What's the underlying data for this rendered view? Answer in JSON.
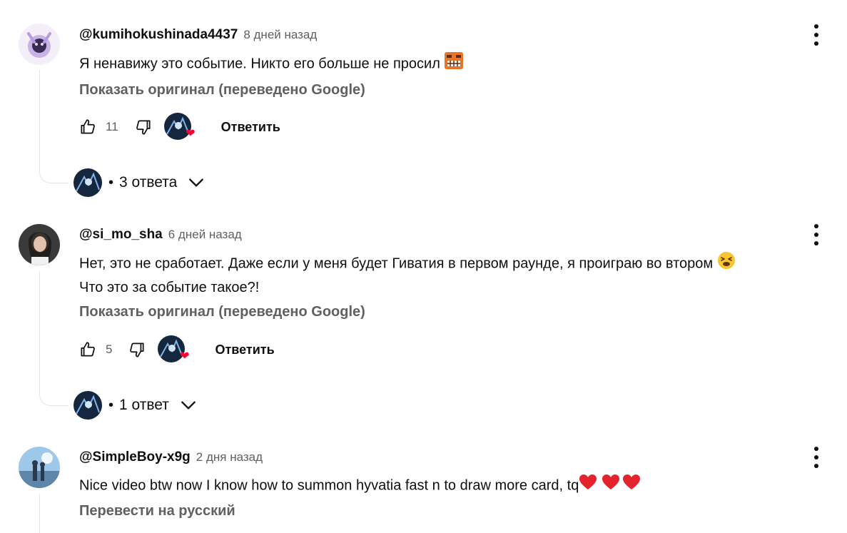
{
  "comments": [
    {
      "author": "@kumihokushinada4437",
      "time": "8 дней назад",
      "text_lines": [
        "Я ненавижу это событие. Никто его больше не просил"
      ],
      "translate_label": "Показать оригинал (переведено Google)",
      "likes": "11",
      "reply_label": "Ответить",
      "replies_label": "3 ответа",
      "emoji": "angry-face-emoji"
    },
    {
      "author": "@si_mo_sha",
      "time": "6 дней назад",
      "text_lines": [
        "Нет, это не сработает. Даже если у меня будет Гиватия в первом раунде, я проиграю во втором",
        "Что это за событие такое?!"
      ],
      "translate_label": "Показать оригинал (переведено Google)",
      "likes": "5",
      "reply_label": "Ответить",
      "replies_label": "1 ответ",
      "emoji": "tired-face-emoji"
    },
    {
      "author": "@SimpleBoy-x9g",
      "time": "2 дня назад",
      "text_lines": [
        "Nice video btw now I know how to summon hyvatia fast n to draw more card, tq"
      ],
      "translate_label": "Перевести на русский",
      "emoji": "red-heart-emoji"
    }
  ],
  "colors": {
    "text_primary": "#0f0f0f",
    "text_secondary": "#606060",
    "heart": "#ff0033",
    "thread_line": "#e5e5e5"
  },
  "separator": "•"
}
